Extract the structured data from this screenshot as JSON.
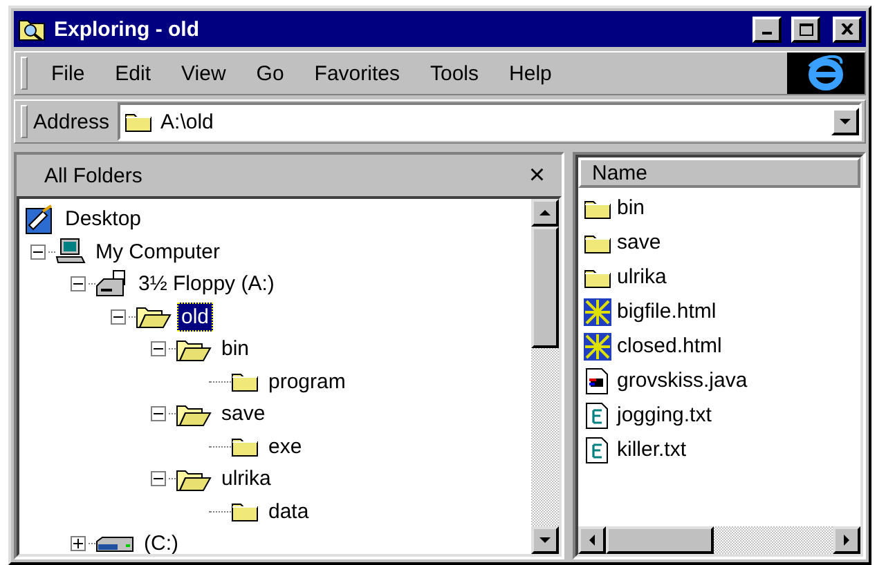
{
  "window": {
    "title": "Exploring - old"
  },
  "menu": [
    "File",
    "Edit",
    "View",
    "Go",
    "Favorites",
    "Tools",
    "Help"
  ],
  "address": {
    "label": "Address",
    "value": "A:\\old"
  },
  "folders_pane": {
    "title": "All Folders",
    "close": "×",
    "tree": [
      {
        "label": "Desktop",
        "kind": "desktop",
        "selected": false,
        "children": [
          {
            "label": "My Computer",
            "kind": "computer",
            "expanded": true,
            "selected": false,
            "children": [
              {
                "label": "3½ Floppy (A:)",
                "kind": "floppy",
                "expanded": true,
                "selected": false,
                "children": [
                  {
                    "label": "old",
                    "kind": "folder",
                    "expanded": true,
                    "selected": true,
                    "children": [
                      {
                        "label": "bin",
                        "kind": "folder",
                        "expanded": true,
                        "selected": false,
                        "children": [
                          {
                            "label": "program",
                            "kind": "folder",
                            "selected": false
                          }
                        ]
                      },
                      {
                        "label": "save",
                        "kind": "folder",
                        "expanded": true,
                        "selected": false,
                        "children": [
                          {
                            "label": "exe",
                            "kind": "folder",
                            "selected": false
                          }
                        ]
                      },
                      {
                        "label": "ulrika",
                        "kind": "folder",
                        "expanded": true,
                        "selected": false,
                        "children": [
                          {
                            "label": "data",
                            "kind": "folder",
                            "selected": false
                          }
                        ]
                      }
                    ]
                  }
                ]
              },
              {
                "label": "(C:)",
                "kind": "drive",
                "expanded": false,
                "selected": false
              }
            ]
          }
        ]
      }
    ]
  },
  "file_list": {
    "columns": [
      "Name"
    ],
    "rows": [
      {
        "name": "bin",
        "kind": "folder"
      },
      {
        "name": "save",
        "kind": "folder"
      },
      {
        "name": "ulrika",
        "kind": "folder"
      },
      {
        "name": "bigfile.html",
        "kind": "html"
      },
      {
        "name": "closed.html",
        "kind": "html"
      },
      {
        "name": "grovskiss.java",
        "kind": "java"
      },
      {
        "name": "jogging.txt",
        "kind": "text"
      },
      {
        "name": "killer.txt",
        "kind": "text"
      }
    ]
  }
}
